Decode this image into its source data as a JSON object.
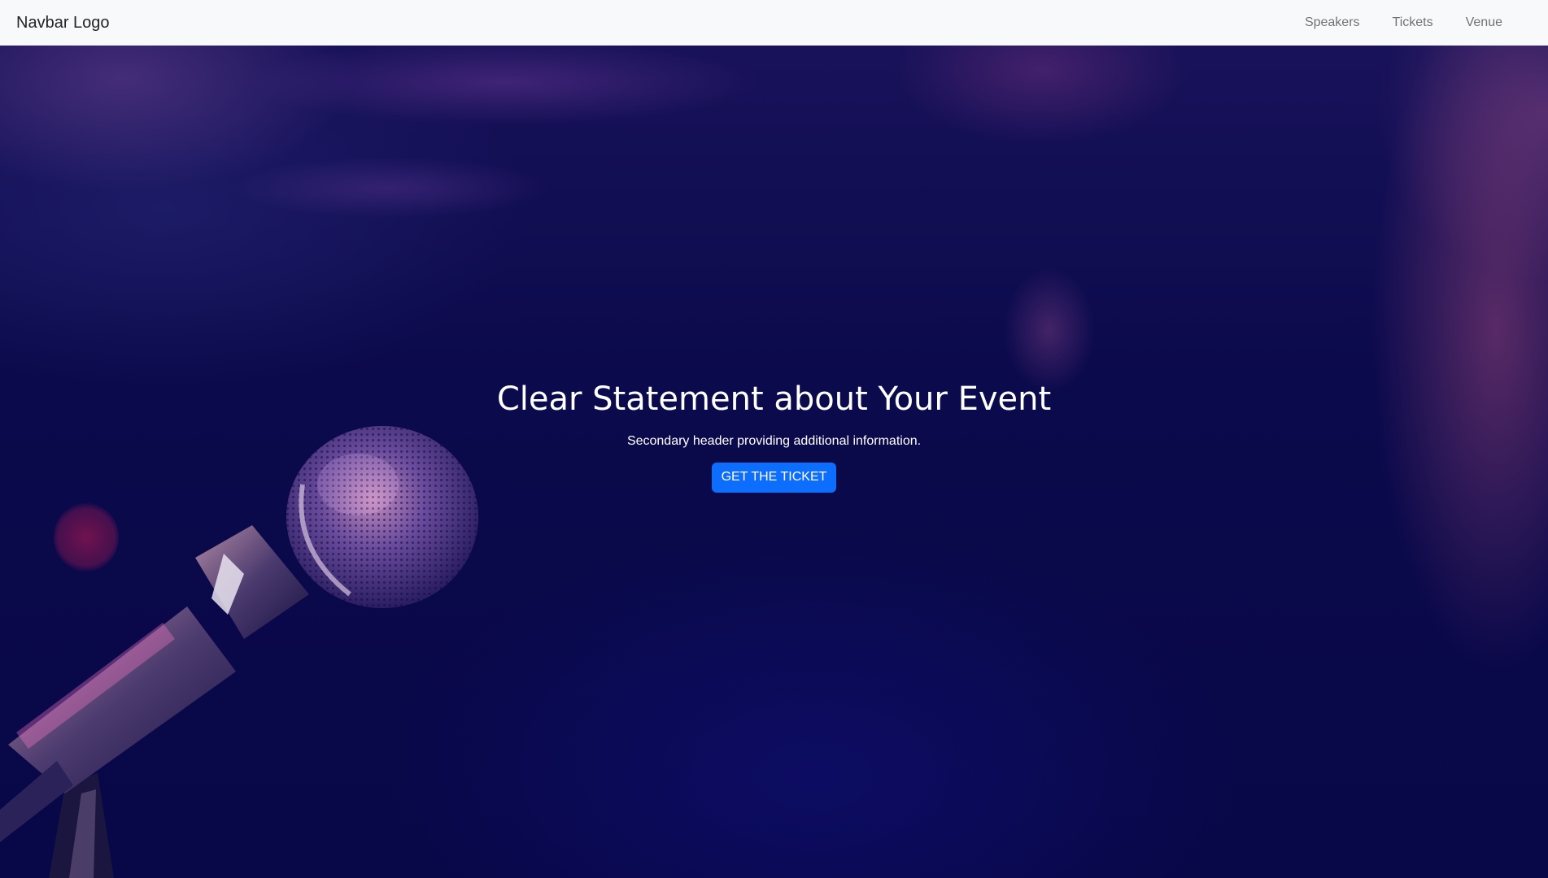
{
  "navbar": {
    "logo": "Navbar Logo",
    "links": [
      {
        "label": "Speakers"
      },
      {
        "label": "Tickets"
      },
      {
        "label": "Venue"
      }
    ]
  },
  "hero": {
    "title": "Clear Statement about Your Event",
    "subtitle": "Secondary header providing additional information.",
    "cta_label": "GET THE TICKET"
  },
  "colors": {
    "navbar_bg": "#f8f9fa",
    "hero_bg": "#0b0a4a",
    "button_primary": "#0d6efd",
    "text_light": "#ffffff"
  }
}
